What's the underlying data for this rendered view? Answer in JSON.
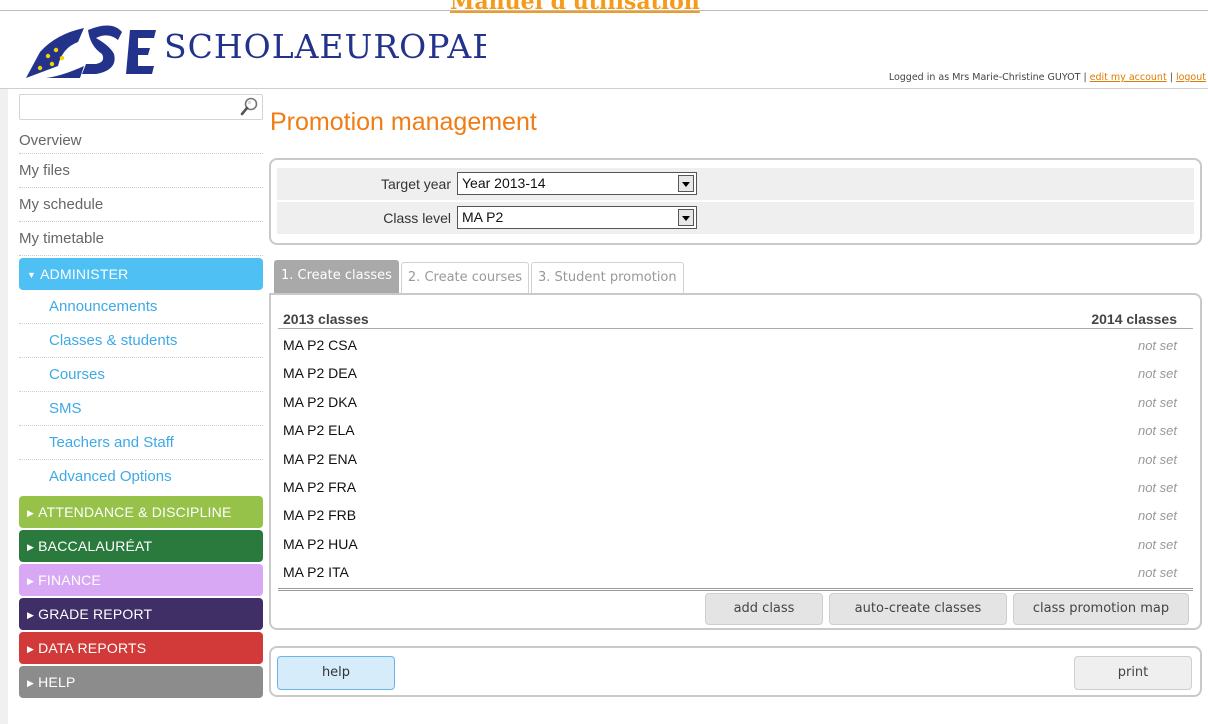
{
  "banner": {
    "manual_link": "Manuel d'utilisation"
  },
  "header": {
    "logo_text": "SCHOLAEUROPAEA",
    "logged_in_text": "Logged in as Mrs Marie-Christine GUYOT",
    "edit_account_link": "edit my account",
    "logout_link": "logout",
    "separator": "|"
  },
  "sidebar": {
    "search": {
      "value": "",
      "placeholder": ""
    },
    "items": [
      {
        "label": "Overview"
      },
      {
        "label": "My files"
      },
      {
        "label": "My schedule"
      },
      {
        "label": "My timetable"
      }
    ],
    "administer": {
      "label": "ADMINISTER",
      "color": "#4ec0f3",
      "subitems": [
        {
          "label": "Announcements"
        },
        {
          "label": "Classes & students"
        },
        {
          "label": "Courses"
        },
        {
          "label": "SMS"
        },
        {
          "label": "Teachers and Staff"
        },
        {
          "label": "Advanced Options"
        }
      ]
    },
    "sections": [
      {
        "label": "ATTENDANCE & DISCIPLINE",
        "color": "#96c24a"
      },
      {
        "label": "BACCALAURÉAT",
        "color": "#2a7a3e"
      },
      {
        "label": "FINANCE",
        "color": "#d8a8f4"
      },
      {
        "label": "GRADE REPORT",
        "color": "#3f2f66"
      },
      {
        "label": "DATA REPORTS",
        "color": "#d23a3a"
      },
      {
        "label": "HELP",
        "color": "#8c8c8c"
      }
    ]
  },
  "main": {
    "title": "Promotion management",
    "filters": {
      "target_year_label": "Target year",
      "target_year_value": "Year 2013-14",
      "class_level_label": "Class level",
      "class_level_value": "MA P2"
    },
    "tabs": [
      {
        "label": "1. Create classes",
        "active": true
      },
      {
        "label": "2. Create courses",
        "active": false
      },
      {
        "label": "3. Student promotion",
        "active": false
      }
    ],
    "table": {
      "col_left": "2013 classes",
      "col_right": "2014 classes",
      "rows": [
        {
          "name": "MA P2 CSA",
          "status": "not set"
        },
        {
          "name": "MA P2 DEA",
          "status": "not set"
        },
        {
          "name": "MA P2 DKA",
          "status": "not set"
        },
        {
          "name": "MA P2 ELA",
          "status": "not set"
        },
        {
          "name": "MA P2 ENA",
          "status": "not set"
        },
        {
          "name": "MA P2 FRA",
          "status": "not set"
        },
        {
          "name": "MA P2 FRB",
          "status": "not set"
        },
        {
          "name": "MA P2 HUA",
          "status": "not set"
        },
        {
          "name": "MA P2 ITA",
          "status": "not set"
        }
      ]
    },
    "buttons": {
      "add_class": "add class",
      "auto_create": "auto-create classes",
      "promotion_map": "class promotion map"
    },
    "footer": {
      "help": "help",
      "print": "print"
    }
  }
}
